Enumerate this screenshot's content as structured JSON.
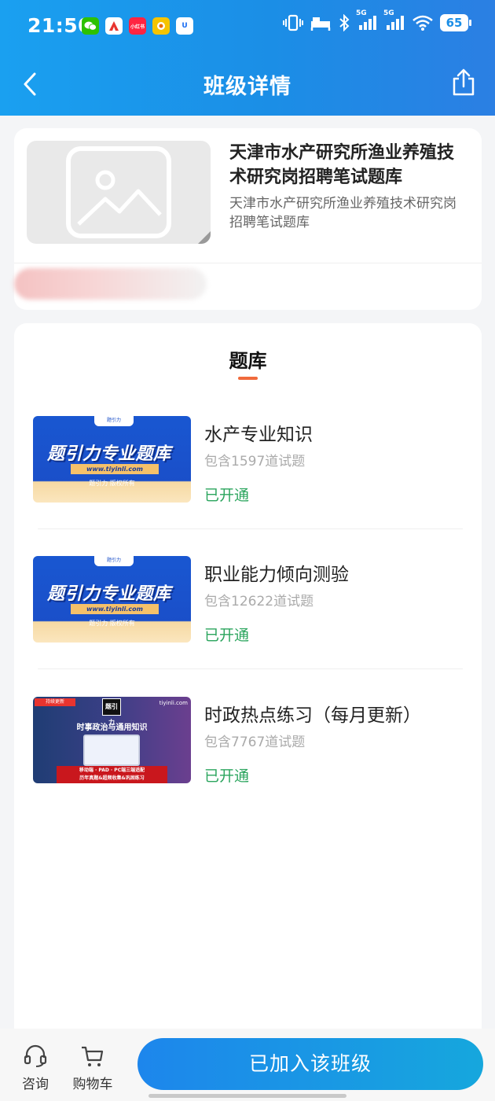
{
  "status_bar": {
    "time": "21:50",
    "network_1": "5G",
    "network_2": "5G",
    "battery": "65",
    "app_icons": [
      {
        "name": "wechat-icon",
        "color": "#2dc100",
        "label": ""
      },
      {
        "name": "aliexpress-icon",
        "color": "#e8342f",
        "label": ""
      },
      {
        "name": "xiaohongshu-icon",
        "color": "#ff2442",
        "label": "小红书"
      },
      {
        "name": "games-icon",
        "color": "#f5c400",
        "label": ""
      },
      {
        "name": "shield-app-icon",
        "color": "#1d6ff2",
        "label": "U"
      }
    ]
  },
  "nav": {
    "title": "班级详情"
  },
  "course": {
    "title": "天津市水产研究所渔业养殖技术研究岗招聘笔试题库",
    "description": "天津市水产研究所渔业养殖技术研究岗招聘笔试题库"
  },
  "bank": {
    "title": "题库",
    "items": [
      {
        "name": "水产专业知识",
        "count": "包含1597道试题",
        "status": "已开通",
        "thumb": {
          "style": "blue",
          "main": "题引力专业题库",
          "url": "www.tiyinli.com",
          "copyright": "题引力 版权所有",
          "badge": "题引力"
        }
      },
      {
        "name": "职业能力倾向测验",
        "count": "包含12622道试题",
        "status": "已开通",
        "thumb": {
          "style": "blue",
          "main": "题引力专业题库",
          "url": "www.tiyinli.com",
          "copyright": "题引力 版权所有",
          "badge": "题引力"
        }
      },
      {
        "name": "时政热点练习（每月更新）",
        "count": "包含7767道试题",
        "status": "已开通",
        "thumb": {
          "style": "purple",
          "tag": "持续更新",
          "site": "tiyinli.com",
          "logo": "题引力",
          "title": "时事政治与通用知识",
          "banner_1": "移动端 · PAD · PC端三端适配",
          "banner_2": "历年真题&超频收集&巩固练习"
        }
      }
    ]
  },
  "bottom": {
    "consult_label": "咨询",
    "cart_label": "购物车",
    "join_label": "已加入该班级"
  },
  "colors": {
    "header_start": "#1aa0f0",
    "header_end": "#2b7fe3",
    "status_green": "#2ba55e",
    "accent_orange": "#f06a3c",
    "button_start": "#1d86ec",
    "button_end": "#16a7dd"
  }
}
